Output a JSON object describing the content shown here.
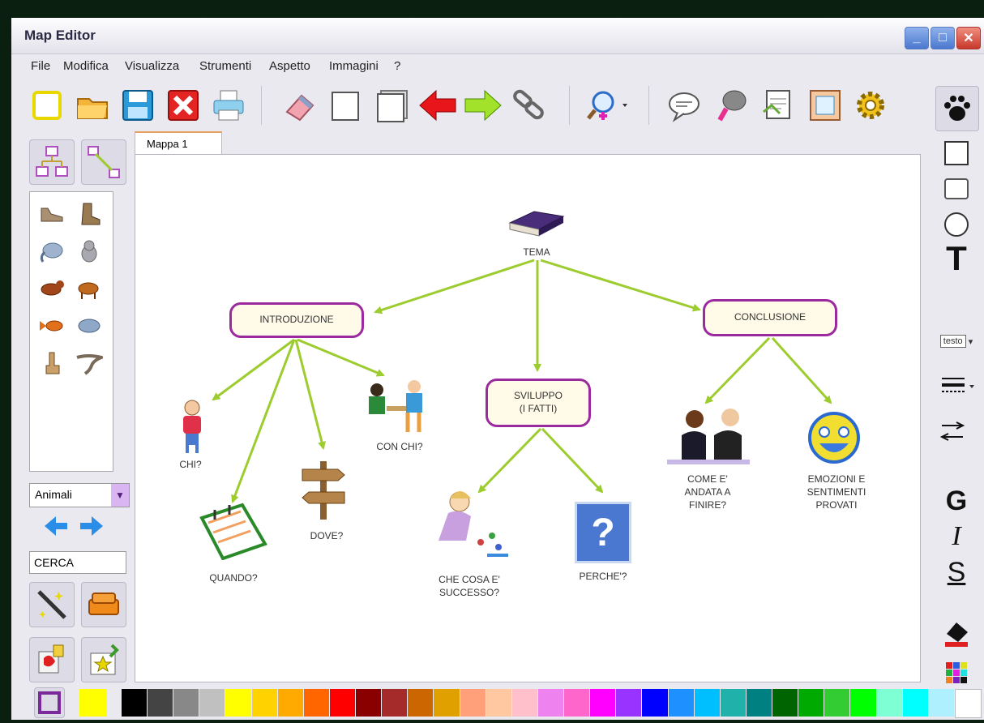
{
  "window": {
    "title": "Map Editor"
  },
  "menu": [
    "File",
    "Modifica",
    "Visualizza",
    "Strumenti",
    "Aspetto",
    "Immagini",
    "?"
  ],
  "toolbar": {
    "file_tools": [
      "new-document-icon",
      "open-folder-icon",
      "save-disk-icon",
      "close-red-x-icon",
      "print-icon"
    ],
    "edit_tools": [
      "eraser-icon",
      "copy-page-icon",
      "paste-page-icon",
      "undo-red-arrow-icon",
      "redo-green-arrow-icon",
      "link-chain-icon"
    ],
    "search_tool": "magnifier-add-icon",
    "view_tools": [
      "speech-balloon-icon",
      "voice-speaker-icon",
      "export-document-icon",
      "image-frame-icon",
      "settings-gear-icon"
    ],
    "paw_tool": "paw-icon"
  },
  "left_panel": {
    "map_tools": [
      "hierarchy-map-icon",
      "connect-nodes-icon"
    ],
    "gallery_icons": [
      "shoe-icon",
      "boot-icon",
      "elephant-icon",
      "cat-icon",
      "dog-icon",
      "cow-icon",
      "fish-icon",
      "hippo-icon",
      "giraffe-icon",
      "lizard-icon"
    ],
    "category_select": "Animali",
    "search_value": "CERCA",
    "bottom_tools": [
      "magic-wand-icon",
      "sofa-icon",
      "paint-tool-icon",
      "star-stamp-icon"
    ]
  },
  "tab": {
    "label": "Mappa 1"
  },
  "map": {
    "root": "TEMA",
    "nodes": {
      "intro": "INTRODUZIONE",
      "sviluppo": "SVILUPPO\n(I FATTI)",
      "conclusione": "CONCLUSIONE"
    },
    "leaves": {
      "chi": "CHI?",
      "quando": "QUANDO?",
      "dove": "DOVE?",
      "conchi": "CON CHI?",
      "checosa": "CHE COSA E'\nSUCCESSO?",
      "perche": "PERCHE'?",
      "come": "COME E'\nANDATA A\nFINIRE?",
      "emozioni": "EMOZIONI E\nSENTIMENTI\nPROVATI"
    },
    "colors": {
      "edge": "#9ccc2e",
      "node_border": "#9a2a9e",
      "node_fill": "#fffbe8"
    }
  },
  "right_panel": {
    "shapes": [
      "rectangle-shape-icon",
      "rounded-rectangle-shape-icon",
      "circle-shape-icon"
    ],
    "text_tool": "T",
    "font_select": "testo",
    "line_style": "line-style-icon",
    "arrow_style": "arrow-style-icon",
    "bold": "G",
    "italic": "I",
    "underline": "S",
    "fill_tool": "paint-bucket-icon",
    "color_grid": "color-grid-icon"
  },
  "palette": {
    "current_border": "#7a2a9a",
    "current_fill": "#ffff00",
    "swatches": [
      "#000000",
      "#444444",
      "#888888",
      "#c0c0c0",
      "#ffff00",
      "#ffd200",
      "#ffaa00",
      "#ff6600",
      "#ff0000",
      "#8a0000",
      "#a52a2a",
      "#cc6600",
      "#e0a000",
      "#ffa07a",
      "#ffc8a0",
      "#ffc0cb",
      "#ee82ee",
      "#ff66cc",
      "#ff00ff",
      "#9933ff",
      "#0000ff",
      "#1e90ff",
      "#00bfff",
      "#20b2aa",
      "#008080",
      "#006400",
      "#00aa00",
      "#33cc33",
      "#00ff00",
      "#7fffd4",
      "#00ffff",
      "#aff0ff",
      "#ffffff"
    ]
  }
}
